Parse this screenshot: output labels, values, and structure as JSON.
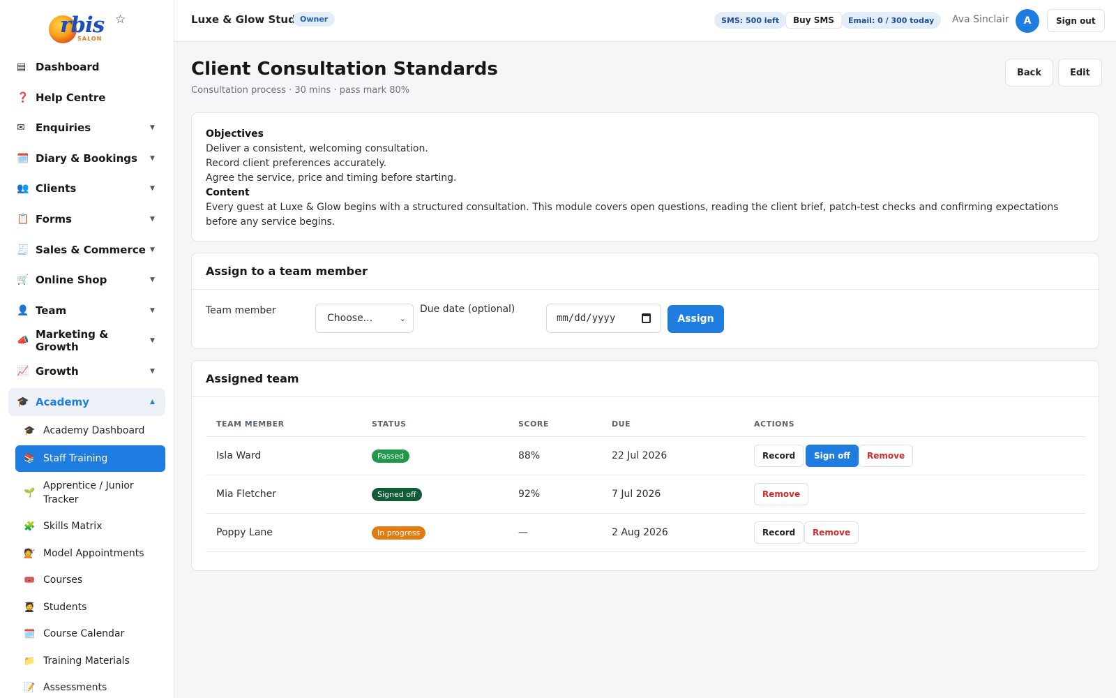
{
  "brand": {
    "logo_text": "rbis",
    "logo_sub": "SALON"
  },
  "topbar": {
    "studio_name": "Luxe & Glow Studio",
    "role_badge": "Owner",
    "sms_left": "SMS: 500 left",
    "buy_sms": "Buy SMS",
    "email_quota": "Email: 0 / 300 today",
    "user_name": "Ava Sinclair",
    "avatar_initial": "A",
    "sign_out": "Sign out"
  },
  "sidebar": {
    "items": [
      {
        "label": "Dashboard",
        "icon": "▤"
      },
      {
        "label": "Help Centre",
        "icon": "❓"
      },
      {
        "label": "Enquiries",
        "icon": "✉"
      },
      {
        "label": "Diary & Bookings",
        "icon": "🗓️"
      },
      {
        "label": "Clients",
        "icon": "👥"
      },
      {
        "label": "Forms",
        "icon": "📋"
      },
      {
        "label": "Sales & Commerce",
        "icon": "🧾"
      },
      {
        "label": "Online Shop",
        "icon": "🛒"
      },
      {
        "label": "Team",
        "icon": "👤"
      },
      {
        "label": "Marketing & Growth",
        "icon": "📣"
      },
      {
        "label": "Growth",
        "icon": "📈"
      },
      {
        "label": "Academy",
        "icon": "🎓"
      }
    ],
    "chevron_closed": "▼",
    "chevron_open": "▲",
    "academy_items": [
      {
        "label": "Academy Dashboard",
        "icon": "🎓"
      },
      {
        "label": "Staff Training",
        "icon": "📚"
      },
      {
        "label": "Apprentice / Junior Tracker",
        "icon": "🌱"
      },
      {
        "label": "Skills Matrix",
        "icon": "🧩"
      },
      {
        "label": "Model Appointments",
        "icon": "💇"
      },
      {
        "label": "Courses",
        "icon": "🎟️"
      },
      {
        "label": "Students",
        "icon": "🧑‍🎓"
      },
      {
        "label": "Course Calendar",
        "icon": "🗓️"
      },
      {
        "label": "Training Materials",
        "icon": "📁"
      },
      {
        "label": "Assessments",
        "icon": "📝"
      }
    ]
  },
  "page": {
    "title": "Client Consultation Standards",
    "subtitle": "Consultation process · 30 mins · pass mark 80%",
    "back_label": "Back",
    "edit_label": "Edit"
  },
  "overview": {
    "objectives_heading": "Objectives",
    "objectives": [
      "Deliver a consistent, welcoming consultation.",
      "Record client preferences accurately.",
      "Agree the service, price and timing before starting."
    ],
    "content_heading": "Content",
    "content": "Every guest at Luxe & Glow begins with a structured consultation. This module covers open questions, reading the client brief, patch-test checks and confirming expectations before any service begins."
  },
  "assign": {
    "heading": "Assign to a team member",
    "member_label": "Team member",
    "member_value": "Choose...",
    "due_label": "Due date (optional)",
    "due_placeholder": "mm/dd/yyyy",
    "assign_button": "Assign"
  },
  "assigned": {
    "heading": "Assigned team",
    "columns": [
      "TEAM MEMBER",
      "STATUS",
      "SCORE",
      "DUE",
      "ACTIONS"
    ],
    "rows": [
      {
        "member": "Isla Ward",
        "status": "Passed",
        "score": "88%",
        "due": "22 Jul 2026",
        "actions": [
          "Record",
          "Sign off",
          "Remove"
        ]
      },
      {
        "member": "Mia Fletcher",
        "status": "Signed off",
        "score": "92%",
        "due": "7 Jul 2026",
        "actions": [
          "Remove"
        ]
      },
      {
        "member": "Poppy Lane",
        "status": "In progress",
        "score": "—",
        "due": "2 Aug 2026",
        "actions": [
          "Record",
          "Remove"
        ]
      }
    ]
  },
  "colors": {
    "accent": "#1f7ce0",
    "passed": "#1f9a4a",
    "signed_off": "#0f5c37",
    "in_progress": "#e07c12",
    "danger": "#d42a2a"
  }
}
